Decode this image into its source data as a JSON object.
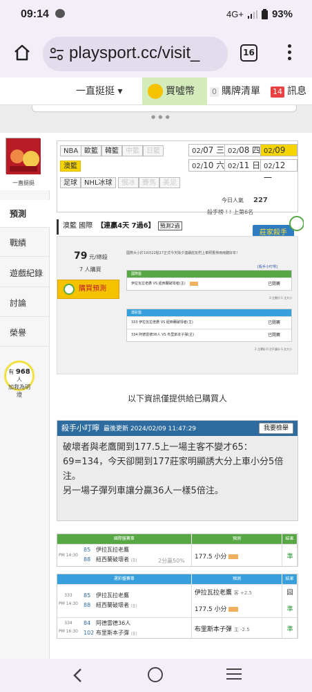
{
  "status_bar": {
    "time": "09:14",
    "network": "4G+",
    "battery": "93%"
  },
  "browser": {
    "url": "playsport.cc/visit_",
    "tab_count": "16"
  },
  "top_nav": {
    "dropdown": "一直挺挺",
    "coin": "買噓幣",
    "cart_count": "0",
    "cart": "購牌清單",
    "msg_count": "14",
    "msg": "訊息"
  },
  "sidebar": {
    "user_name": "一直挺挺",
    "items": [
      "預測",
      "戰績",
      "遊戲紀錄",
      "討論",
      "榮譽"
    ],
    "fans_prefix": "有",
    "fans_count": "968",
    "fans_unit": "人",
    "fans_suffix": "加我為明燈"
  },
  "leagues": {
    "row1": [
      "NBA",
      "歐籃",
      "韓籃",
      "中籃",
      "日籃"
    ],
    "row2": [
      "澳籃"
    ],
    "row3": [
      "足球",
      "NHL冰球",
      "俄冰",
      "賽馬",
      "美足"
    ]
  },
  "dates": [
    {
      "md": "02/",
      "d": "07 三"
    },
    {
      "md": "02/",
      "d": "08 四"
    },
    {
      "md": "02/",
      "d": "09 五"
    },
    {
      "md": "02/",
      "d": "10 六"
    },
    {
      "md": "02/",
      "d": "11 日"
    },
    {
      "md": "02/",
      "d": "12 一"
    }
  ],
  "stats": {
    "visitors_label": "今日人氣",
    "visitors": "227",
    "rank": "殺手榜 ! ! 上第6名"
  },
  "prediction": {
    "league": "澳籃 國際",
    "streak": "【連贏4天 7過6】",
    "badge": "預測2過",
    "stamp": "莊家殺手"
  },
  "preview": {
    "coins": "79",
    "coins_unit": "元/總殺",
    "buyers": "7 人購買",
    "buy_button": "購買預測",
    "note": "國際大小於19日22點17正式今天除夕連續莊友們上車照舊佈雨雨聽好年！",
    "link": "[殺手小叮嚀]",
    "block1_head": "國際盤",
    "block1_btn": "展示盤口",
    "block1_row": "伊拉瓦拉老鷹 VS 紐西蘭破壞者(主)",
    "block1_res": "已開賽",
    "block1_foot": "0 注需付‧1 注大小",
    "block2_head": "運彩盤",
    "block2_btn": "展示盤口",
    "block2_rows": [
      {
        "no": "333",
        "match": "伊拉瓦拉老鷹 VS 紐西蘭破壞者(主)",
        "res": "已開賽"
      },
      {
        "no": "334",
        "match": "阿德雷德36人 VS 布里斯本子彈(主)",
        "res": "已開賽"
      }
    ],
    "block2_foot": "2 注運彩‧0 注不讓分‧1 注大小"
  },
  "info_line": "以下資訊僅提供給已購買人",
  "tips": {
    "title": "殺手小叮嚀",
    "updated": "最後更新 2024/02/09 11:47:29",
    "report": "我要檢舉",
    "body": "破壞者與老鷹開到177.5上一場主客不變才65：69=134，今天卻開到177莊家明顯誘大分上車小分5倍注。\n另一場子彈列車讓分贏36人一樣5倍注。"
  },
  "table_intl": {
    "headers": [
      "國際盤賽事",
      "預測",
      "結果"
    ],
    "time": "PM 14:30",
    "team1_no": "85",
    "team1": "伊拉瓦拉老鷹",
    "team2_no": "88",
    "team2": "紐西蘭破壞者",
    "home": "(主)",
    "ratio": "2分贏50%",
    "pick": "177.5 小分",
    "result": "準"
  },
  "table_sports": {
    "headers": [
      "運彩盤賽事",
      "預測",
      "結果"
    ],
    "rows": [
      {
        "no": "333",
        "time": "PM 14:30",
        "team1_no": "85",
        "team1": "伊拉瓦拉老鷹",
        "team2_no": "88",
        "team2": "紐西蘭破壞者",
        "home": "(主)",
        "pick1": "伊拉瓦拉老鷹",
        "pick1_odd": "客 +2.5",
        "res1": "囧",
        "pick2": "177.5 小分",
        "res2": "準"
      },
      {
        "no": "334",
        "time": "PM 16:30",
        "team1_no": "84",
        "team1": "阿德雷德36人",
        "team2_no": "102",
        "team2": "布里斯本子彈",
        "home": "(主)",
        "pick1": "布里斯本子彈",
        "pick1_odd": "主 -2.5",
        "res1": "準"
      }
    ]
  }
}
